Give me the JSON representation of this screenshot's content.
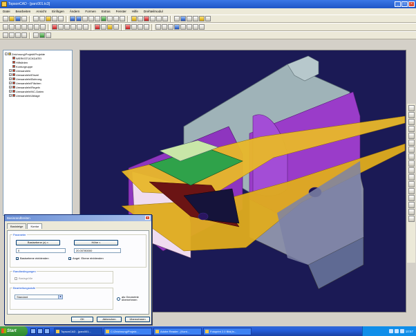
{
  "window": {
    "title": "TopsonCAD - [parc001.tc3]",
    "controls": [
      "_",
      "□",
      "×"
    ]
  },
  "menubar": [
    "Datei",
    "Bearbeiten",
    "Ansicht",
    "Einfügen",
    "Ändern",
    "Formen",
    "Extras",
    "Fenster",
    "Hilfe",
    "Drehteilmodul"
  ],
  "tree": {
    "items": [
      {
        "label": "Zeichnung\\Projekt\\Projekte",
        "icon": "folder-icon",
        "indent": 0,
        "pm": "-"
      },
      {
        "label": "WERKSTÜCKDATEI",
        "icon": "part-icon",
        "indent": 1,
        "pm": ""
      },
      {
        "label": "Hilfslinien",
        "icon": "layer-icon",
        "indent": 1,
        "pm": ""
      },
      {
        "label": "Konturgruppe",
        "icon": "layer-icon",
        "indent": 1,
        "pm": ""
      },
      {
        "label": "Umwandeln",
        "icon": "layer-icon",
        "indent": 1,
        "pm": "+"
      },
      {
        "label": "Umwandeln\\Einzel",
        "icon": "layer-icon",
        "indent": 1,
        "pm": "+"
      },
      {
        "label": "Umwandeln\\Bohrung",
        "icon": "layer-icon",
        "indent": 1,
        "pm": "+"
      },
      {
        "label": "Umwandeln\\Flächen",
        "icon": "layer-icon",
        "indent": 1,
        "pm": "+"
      },
      {
        "label": "Umwandeln\\Regeln",
        "icon": "layer-icon",
        "indent": 1,
        "pm": "+"
      },
      {
        "label": "Umwandeln\\NC-Daten",
        "icon": "layer-icon",
        "indent": 1,
        "pm": "+"
      },
      {
        "label": "Umwandeln\\Ablage",
        "icon": "layer-icon",
        "indent": 1,
        "pm": "+"
      }
    ]
  },
  "dialog": {
    "title": "Basisrandbreiten",
    "close": "×",
    "tabs": [
      "Basisteige",
      "Kontur"
    ],
    "active_tab": "Kontur",
    "parameter_group": "Parameter",
    "btn_basis": "Basisebene (z) <",
    "btn_hoehe": "Höhe <",
    "field_basis": "0",
    "field_hoehe": "20.00780000",
    "check1": "Basisebene einblenden",
    "check2": "Angel. Ebene einblenden",
    "group2": "Randbedingungen",
    "group2_option": "Basisgröße",
    "group3": "Bearbeitungsstufe",
    "select_value": "Standard",
    "radio_label": "als Geometrie übernehmen",
    "btn_ok": "OK",
    "btn_cancel": "Abbrechen",
    "btn_apply": "Übernehmen"
  },
  "taskbar": {
    "start": "Start",
    "tasks": [
      "TopsonCAD - [parc001...",
      "C:\\Zeichnung\\Projekt...",
      "Adobe Reader - [Kont...",
      "Fotoprint 2.0 Bild(In..."
    ],
    "active_task_index": 0,
    "clock": "10:57"
  },
  "colors": {
    "viewport_bg": "#1b1a55",
    "model_grey": "#9fb3b8",
    "model_purple": "#9a3cc9",
    "model_yellow": "#e8b82a",
    "model_green": "#2fa24a"
  }
}
